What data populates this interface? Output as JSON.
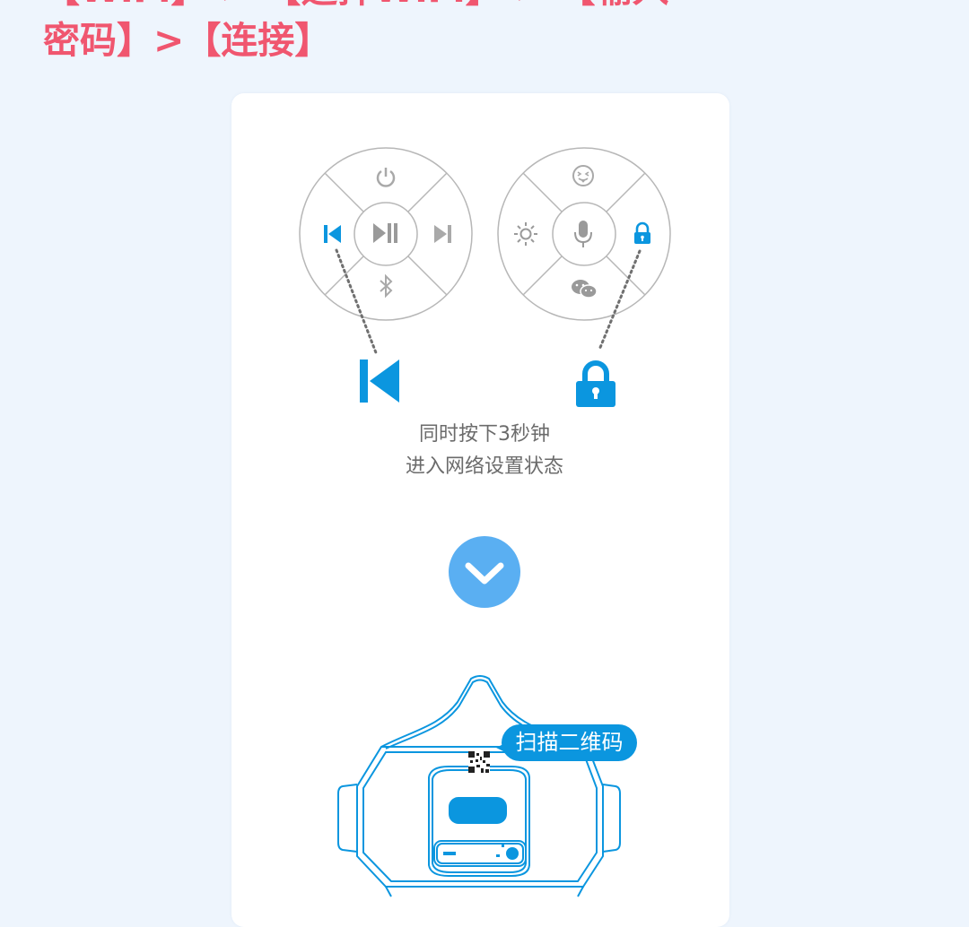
{
  "heading": {
    "line_cut": "【WiFi】 > 【选择WiFi】 > 【输入",
    "line_main": "密码】>【连接】"
  },
  "controls": {
    "left": {
      "up": "power-icon",
      "left": "previous-track-icon",
      "center": "play-pause-icon",
      "right": "next-track-icon",
      "down": "bluetooth-icon",
      "highlighted": "previous-track-icon"
    },
    "right": {
      "up": "emoji-icon",
      "left": "light-icon",
      "center": "microphone-icon",
      "right": "lock-icon",
      "down": "wechat-icon",
      "highlighted": "lock-icon"
    }
  },
  "instructions": {
    "line1": "同时按下3秒钟",
    "line2": "进入网络设置状态"
  },
  "next_button": {
    "icon": "chevron-down-icon"
  },
  "device": {
    "scan_label": "扫描二维码"
  },
  "colors": {
    "heading": "#f0566f",
    "accent_blue": "#0b96df",
    "button_blue": "#5aaff2",
    "ring_gray": "#b7b7b7",
    "page_bg": "#eef5fd"
  }
}
